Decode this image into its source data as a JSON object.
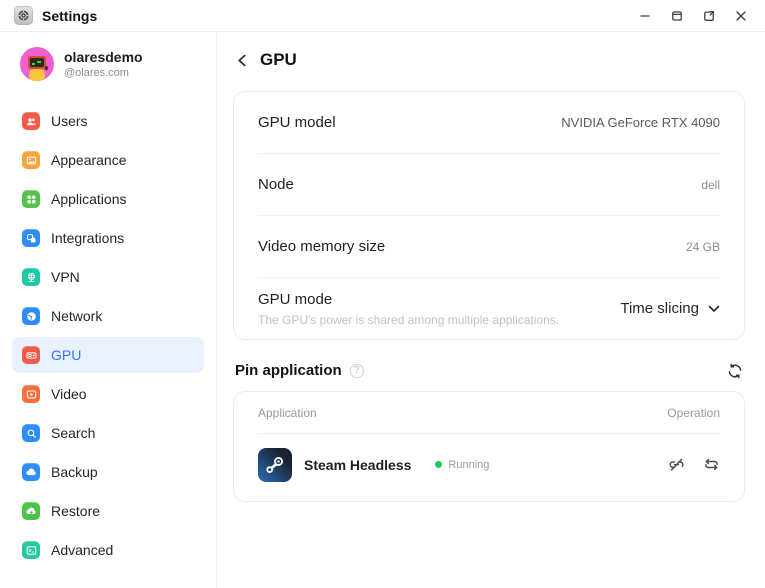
{
  "window": {
    "title": "Settings",
    "controls": [
      {
        "name": "minimize",
        "icon": "minimize-icon"
      },
      {
        "name": "restore",
        "icon": "restore-icon"
      },
      {
        "name": "popout",
        "icon": "open-in-new-icon"
      },
      {
        "name": "close",
        "icon": "close-icon"
      }
    ]
  },
  "user": {
    "name": "olaresdemo",
    "handle": "@olares.com"
  },
  "sidebar": {
    "items": [
      {
        "label": "Users",
        "icon": "users-icon",
        "color": "#F15B4B",
        "selected": false
      },
      {
        "label": "Appearance",
        "icon": "appearance-icon",
        "color": "#F9A43E",
        "selected": false
      },
      {
        "label": "Applications",
        "icon": "applications-icon",
        "color": "#57C14D",
        "selected": false
      },
      {
        "label": "Integrations",
        "icon": "integrations-icon",
        "color": "#2F8CF6",
        "selected": false
      },
      {
        "label": "VPN",
        "icon": "vpn-icon",
        "color": "#1EC9A6",
        "selected": false
      },
      {
        "label": "Network",
        "icon": "network-icon",
        "color": "#2E8DF5",
        "selected": false
      },
      {
        "label": "GPU",
        "icon": "gpu-icon",
        "color": "#F15B4B",
        "selected": true
      },
      {
        "label": "Video",
        "icon": "video-icon",
        "color": "#F76F3B",
        "selected": false
      },
      {
        "label": "Search",
        "icon": "search-icon",
        "color": "#2F8DF6",
        "selected": false
      },
      {
        "label": "Backup",
        "icon": "backup-icon",
        "color": "#2F8DF6",
        "selected": false
      },
      {
        "label": "Restore",
        "icon": "restore-cloud-icon",
        "color": "#4FC24A",
        "selected": false
      },
      {
        "label": "Advanced",
        "icon": "advanced-icon",
        "color": "#2AC7A2",
        "selected": false
      }
    ]
  },
  "page": {
    "title": "GPU"
  },
  "gpu_card": {
    "rows": [
      {
        "label": "GPU model",
        "value": "NVIDIA GeForce RTX 4090",
        "value_style": "md"
      },
      {
        "label": "Node",
        "value": "dell",
        "value_style": "sm"
      },
      {
        "label": "Video memory size",
        "value": "24 GB",
        "value_style": "sm"
      },
      {
        "label": "GPU mode",
        "sublabel": "The GPU's power is shared among multiple applications.",
        "value": "Time slicing",
        "value_style": "select"
      }
    ]
  },
  "pin_section": {
    "title": "Pin application",
    "help_glyph": "?"
  },
  "table": {
    "headers": [
      "Application",
      "Operation"
    ],
    "rows": [
      {
        "app": "Steam Headless",
        "status": "Running",
        "status_color": "#22C55E",
        "operations": [
          "unbind-icon",
          "restart-icon"
        ]
      }
    ]
  },
  "colors": {
    "accent": "#3377FF",
    "selected_bg": "#E8F1FD",
    "running": "#22C55E"
  }
}
